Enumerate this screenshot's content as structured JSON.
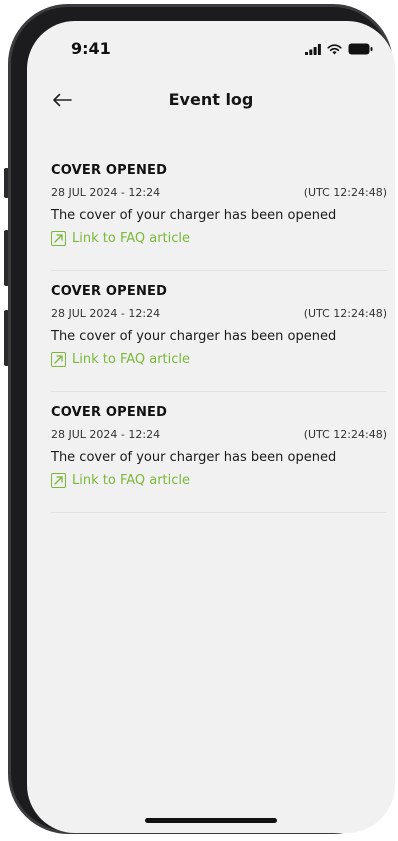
{
  "status_bar": {
    "time": "9:41"
  },
  "header": {
    "title": "Event log"
  },
  "events": [
    {
      "title": "COVER OPENED",
      "date": "28 JUL 2024 - 12:24",
      "utc": "(UTC 12:24:48)",
      "description": "The cover of your charger has been opened",
      "link": "Link to FAQ article"
    },
    {
      "title": "COVER OPENED",
      "date": "28 JUL 2024 - 12:24",
      "utc": "(UTC 12:24:48)",
      "description": "The cover of your charger has been opened",
      "link": "Link to FAQ article"
    },
    {
      "title": "COVER OPENED",
      "date": "28 JUL 2024 - 12:24",
      "utc": "(UTC 12:24:48)",
      "description": "The cover of your charger has been opened",
      "link": "Link to FAQ article"
    }
  ],
  "colors": {
    "accent": "#7ab83a",
    "background": "#f1f1f1",
    "text": "#111111"
  }
}
